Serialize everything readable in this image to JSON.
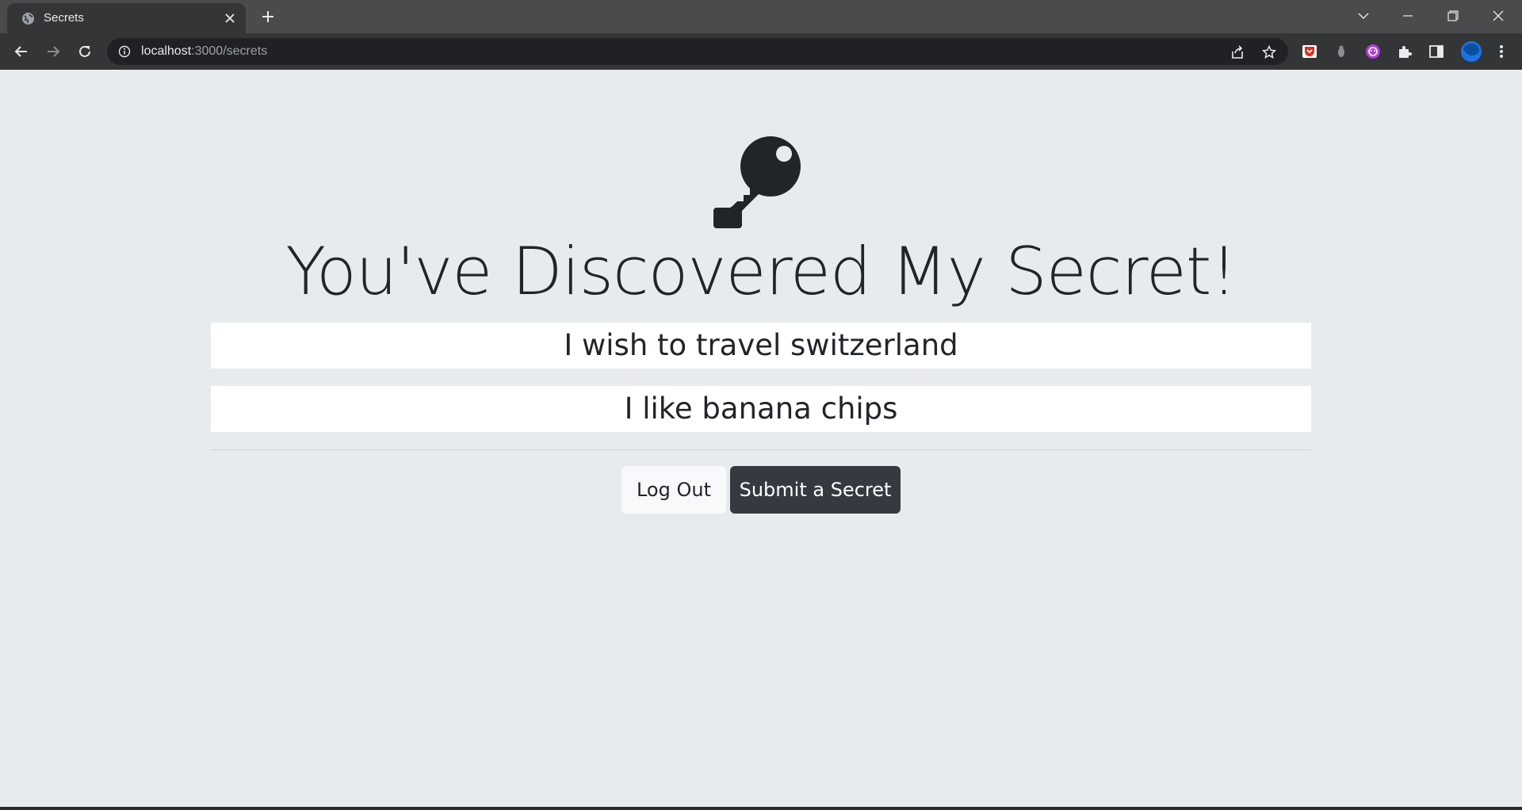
{
  "browser": {
    "tab_title": "Secrets",
    "url_host": "localhost",
    "url_path": ":3000/secrets",
    "icons": [
      "globe-icon",
      "close-icon",
      "plus-icon",
      "chevron-down-icon",
      "minimize-icon",
      "restore-icon",
      "window-close-icon",
      "back-icon",
      "forward-icon",
      "reload-icon",
      "info-icon",
      "share-icon",
      "star-icon",
      "extensions"
    ]
  },
  "page": {
    "headline": "You've Discovered My Secret!",
    "secrets": [
      "I wish to travel switzerland",
      "I like banana chips"
    ],
    "logout_label": "Log Out",
    "submit_label": "Submit a Secret"
  },
  "colors": {
    "background": "#e8ebee",
    "text": "#212529",
    "dark_button": "#343a40",
    "light_button": "#f8f9fa"
  }
}
